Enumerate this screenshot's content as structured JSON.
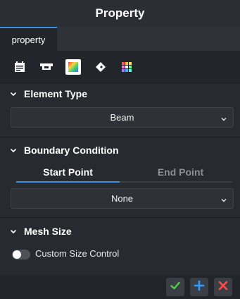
{
  "title": "Property",
  "tabs": [
    {
      "label": "property",
      "active": true
    }
  ],
  "toolbar": {
    "icons": [
      "calendar-icon",
      "tray-icon",
      "color-palette-icon",
      "link-icon",
      "grid-icon"
    ],
    "active_icon": "color-palette-icon"
  },
  "element_type": {
    "header": "Element Type",
    "value": "Beam"
  },
  "boundary_condition": {
    "header": "Boundary Condition",
    "tabs": [
      "Start Point",
      "End Point"
    ],
    "active_tab": "Start Point",
    "value": "None"
  },
  "mesh_size": {
    "header": "Mesh Size",
    "custom_size_label": "Custom Size Control",
    "custom_size_enabled": false
  },
  "footer": {
    "buttons": [
      "check-icon",
      "plus-icon",
      "close-icon"
    ]
  },
  "colors": {
    "accent": "#3b8fe0",
    "check": "#4ccf4c",
    "plus": "#2e9bff",
    "close": "#ff4a4a"
  }
}
